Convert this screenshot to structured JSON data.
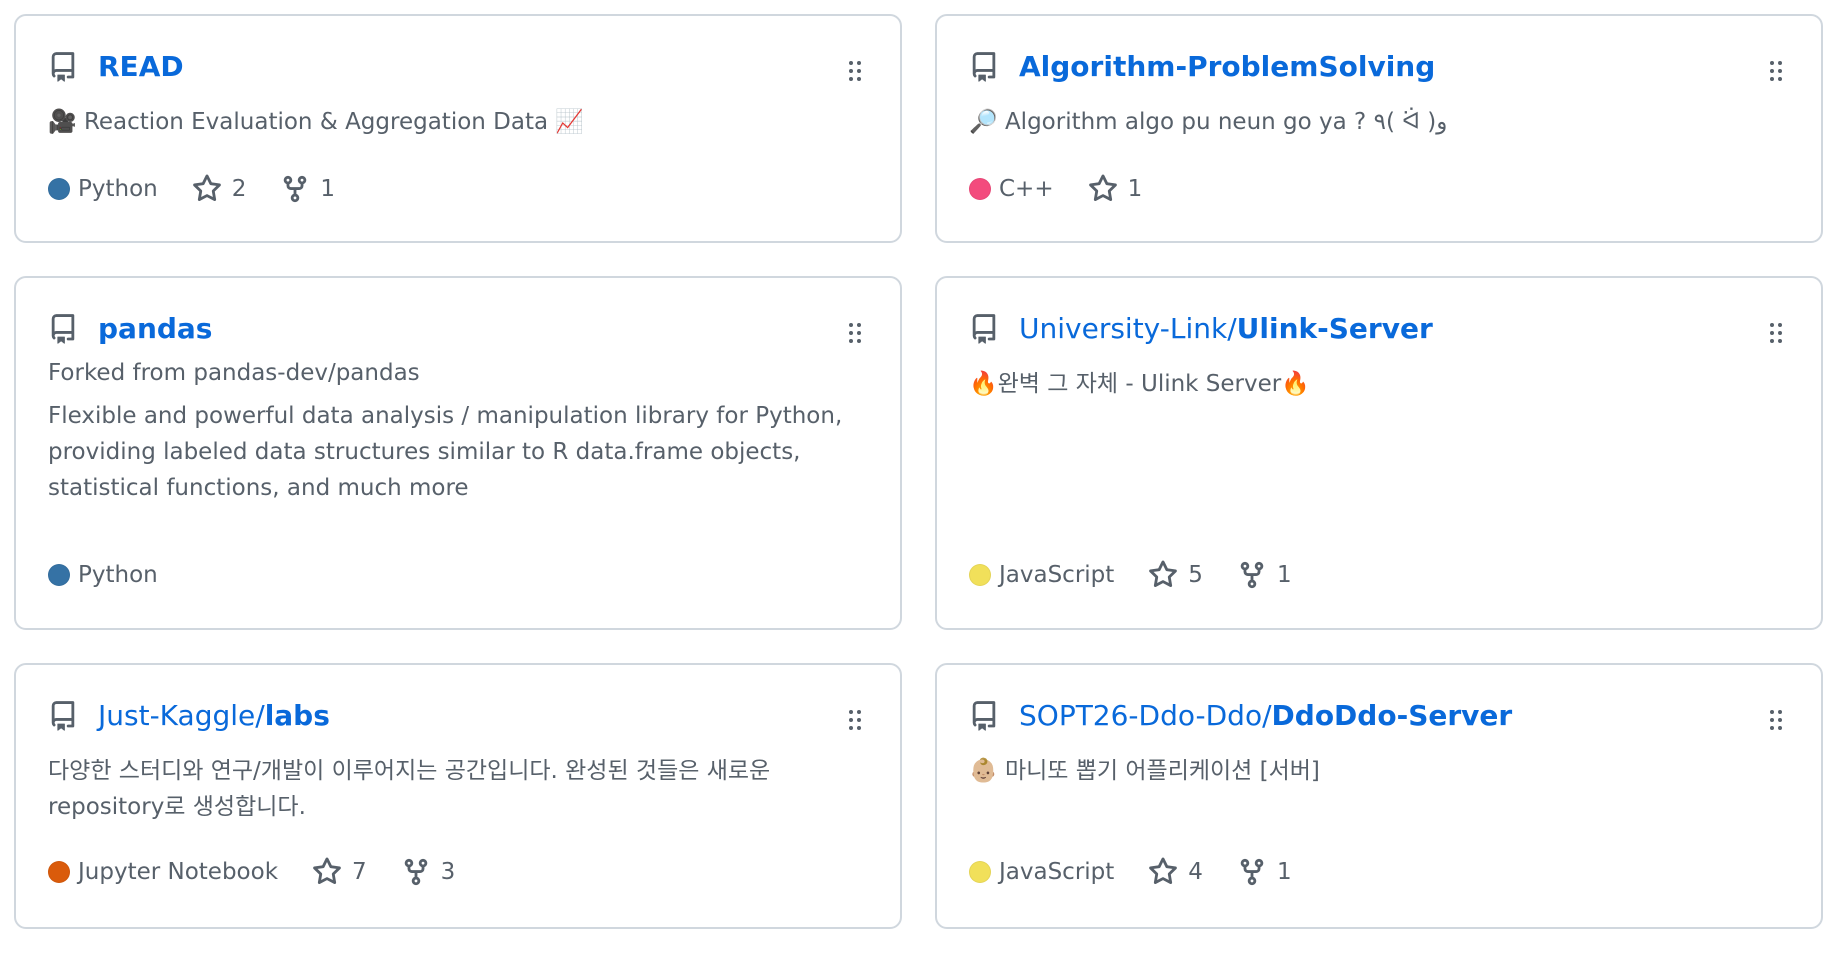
{
  "pinned_repos": [
    {
      "owner": "",
      "name": "READ",
      "forked_prefix": "",
      "forked_from": "",
      "description": "🎥 Reaction Evaluation & Aggregation Data 📈",
      "language": "Python",
      "language_color": "#3572A5",
      "stars": "2",
      "forks": "1"
    },
    {
      "owner": "",
      "name": "Algorithm-ProblemSolving",
      "forked_prefix": "",
      "forked_from": "",
      "description": "🔎 Algorithm algo pu neun go ya ? ٩( ᐛ )و",
      "language": "C++",
      "language_color": "#f34b7d",
      "stars": "1",
      "forks": ""
    },
    {
      "owner": "",
      "name": "pandas",
      "forked_prefix": "Forked from ",
      "forked_from": "pandas-dev/pandas",
      "description": "Flexible and powerful data analysis / manipulation library for Python, providing labeled data structures similar to R data.frame objects, statistical functions, and much more",
      "language": "Python",
      "language_color": "#3572A5",
      "stars": "",
      "forks": ""
    },
    {
      "owner": "University-Link/",
      "name": "Ulink-Server",
      "forked_prefix": "",
      "forked_from": "",
      "description": "🔥완벽 그 자체 - Ulink Server🔥",
      "language": "JavaScript",
      "language_color": "#f1e05a",
      "stars": "5",
      "forks": "1"
    },
    {
      "owner": "Just-Kaggle/",
      "name": "labs",
      "forked_prefix": "",
      "forked_from": "",
      "description": "다양한 스터디와 연구/개발이 이루어지는 공간입니다. 완성된 것들은 새로운 repository로 생성합니다.",
      "language": "Jupyter Notebook",
      "language_color": "#DA5B0B",
      "stars": "7",
      "forks": "3"
    },
    {
      "owner": "SOPT26-Ddo-Ddo/",
      "name": "DdoDdo-Server",
      "forked_prefix": "",
      "forked_from": "",
      "description": "👶🏼 마니또 뽑기 어플리케이션 [서버]",
      "language": "JavaScript",
      "language_color": "#f1e05a",
      "stars": "4",
      "forks": "1"
    }
  ],
  "icons": {
    "repo": "repo-icon",
    "drag": "grabber-icon",
    "star": "star-icon",
    "fork": "repo-forked-icon"
  }
}
